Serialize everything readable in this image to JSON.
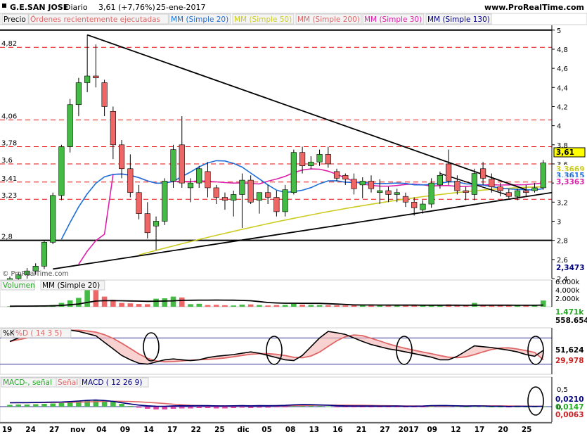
{
  "header": {
    "title": "G.E.SAN JOSE",
    "period": "Diario",
    "quote": "3,61 (+7,76%)",
    "date": "25-ene-2017",
    "site": "www.ProRealTime.com"
  },
  "legend_price": [
    {
      "label": "Precio",
      "color": "#000000"
    },
    {
      "label": "Órdenes recientemente ejecutadas",
      "color": "#e06666"
    },
    {
      "label": "MM (Simple 20)",
      "color": "#1e6fd9"
    },
    {
      "label": "MM (Simple 50)",
      "color": "#cccc22"
    },
    {
      "label": "MM (Simple 200)",
      "color": "#e06666"
    },
    {
      "label": "MM (Simple 30)",
      "color": "#dd22aa"
    },
    {
      "label": "MM (Simple 130)",
      "color": "#000080"
    }
  ],
  "watermark": "© ProRealTime.com",
  "price_axis": {
    "ticks": [
      "5",
      "4,8",
      "4,6",
      "4,4",
      "4,2",
      "4",
      "3,8",
      "3,6",
      "3,4",
      "3,2",
      "3",
      "2,8",
      "2,6",
      "2,4"
    ],
    "left_levels": [
      "4,82",
      "4,06",
      "3,78",
      "3,6",
      "3,41",
      "3,23",
      "2,8"
    ],
    "badges": [
      {
        "text": "3,61",
        "bg": "#ffff00",
        "fg": "#000000"
      },
      {
        "text": "3,3669",
        "bg": "#ffffff",
        "fg": "#cccc22"
      },
      {
        "text": "3,3615",
        "bg": "#ffffff",
        "fg": "#1e6fd9"
      },
      {
        "text": "3,3363",
        "bg": "#ffffff",
        "fg": "#dd22aa"
      },
      {
        "text": "2,3473",
        "bg": "#ffffff",
        "fg": "#000080"
      }
    ]
  },
  "volume_panel": {
    "legend": [
      {
        "label": "Volumen",
        "color": "#22aa22"
      },
      {
        "label": "MM (Simple 20)",
        "color": "#000000"
      }
    ],
    "ticks": [
      "6.000k",
      "4.000k",
      "2.000k"
    ],
    "badges": [
      {
        "text": "1.471k",
        "fg": "#22aa22"
      },
      {
        "text": "558.654",
        "fg": "#000000"
      }
    ]
  },
  "stoch_panel": {
    "legend": [
      {
        "label": "%K",
        "color": "#000000"
      },
      {
        "label": "%D ( 14 3 5)",
        "color": "#e06666"
      }
    ],
    "badges": [
      {
        "text": "51,624",
        "fg": "#000000"
      },
      {
        "text": "29,978",
        "fg": "#cc2222"
      }
    ]
  },
  "macd_panel": {
    "legend": [
      {
        "label": "MACD-, señal",
        "color": "#22aa22"
      },
      {
        "label": "Señal",
        "color": "#e06666"
      },
      {
        "label": "MACD ( 12 26 9)",
        "color": "#000080"
      }
    ],
    "ticks": [
      "0,5",
      "0"
    ],
    "badges": [
      {
        "text": "0,0210",
        "fg": "#000080"
      },
      {
        "text": "0,0147",
        "fg": "#22aa22"
      },
      {
        "text": "0,0063",
        "fg": "#cc2222"
      }
    ]
  },
  "x_axis": {
    "labels": [
      "19",
      "24",
      "27",
      "nov",
      "04",
      "09",
      "14",
      "17",
      "22",
      "25",
      "dic",
      "05",
      "08",
      "13",
      "16",
      "21",
      "27",
      "2017",
      "09",
      "12",
      "17",
      "20",
      "25"
    ]
  },
  "chart_data": {
    "type": "candlestick",
    "instrument": "G.E.SAN JOSE",
    "ylim": [
      2.4,
      5.05
    ],
    "candles": [
      [
        2.35,
        2.42,
        2.28,
        2.4
      ],
      [
        2.4,
        2.47,
        2.36,
        2.44
      ],
      [
        2.44,
        2.51,
        2.4,
        2.48
      ],
      [
        2.48,
        2.56,
        2.44,
        2.53
      ],
      [
        2.53,
        2.8,
        2.5,
        2.78
      ],
      [
        2.78,
        3.3,
        2.76,
        3.27
      ],
      [
        3.27,
        3.8,
        3.22,
        3.78
      ],
      [
        3.78,
        4.28,
        3.72,
        4.22
      ],
      [
        4.22,
        4.5,
        4.1,
        4.45
      ],
      [
        4.45,
        4.95,
        4.35,
        4.52
      ],
      [
        4.52,
        4.85,
        4.4,
        4.5
      ],
      [
        4.45,
        4.48,
        4.1,
        4.2
      ],
      [
        4.15,
        4.2,
        3.65,
        3.8
      ],
      [
        3.8,
        3.85,
        3.45,
        3.55
      ],
      [
        3.55,
        3.7,
        3.25,
        3.3
      ],
      [
        3.3,
        3.38,
        3.02,
        3.08
      ],
      [
        3.08,
        3.2,
        2.82,
        2.88
      ],
      [
        2.95,
        3.05,
        2.7,
        3.0
      ],
      [
        3.0,
        3.45,
        2.96,
        3.42
      ],
      [
        3.42,
        3.8,
        3.35,
        3.75
      ],
      [
        3.8,
        4.1,
        3.35,
        3.4
      ],
      [
        3.35,
        3.45,
        3.2,
        3.4
      ],
      [
        3.4,
        3.58,
        3.35,
        3.55
      ],
      [
        3.52,
        3.62,
        3.25,
        3.35
      ],
      [
        3.35,
        3.38,
        3.18,
        3.25
      ],
      [
        3.25,
        3.3,
        3.12,
        3.22
      ],
      [
        3.22,
        3.32,
        3.05,
        3.28
      ],
      [
        3.28,
        3.5,
        2.93,
        3.43
      ],
      [
        3.43,
        3.48,
        3.18,
        3.2
      ],
      [
        3.22,
        3.3,
        3.08,
        3.3
      ],
      [
        3.3,
        3.38,
        3.18,
        3.25
      ],
      [
        3.25,
        3.32,
        3.05,
        3.1
      ],
      [
        3.1,
        3.38,
        3.05,
        3.33
      ],
      [
        3.3,
        3.75,
        3.28,
        3.72
      ],
      [
        3.72,
        3.78,
        3.5,
        3.58
      ],
      [
        3.58,
        3.68,
        3.55,
        3.62
      ],
      [
        3.62,
        3.75,
        3.58,
        3.7
      ],
      [
        3.7,
        3.78,
        3.56,
        3.6
      ],
      [
        3.52,
        3.55,
        3.42,
        3.45
      ],
      [
        3.48,
        3.5,
        3.38,
        3.44
      ],
      [
        3.44,
        3.5,
        3.28,
        3.34
      ],
      [
        3.38,
        3.46,
        3.24,
        3.42
      ],
      [
        3.42,
        3.48,
        3.3,
        3.34
      ],
      [
        3.3,
        3.44,
        3.18,
        3.32
      ],
      [
        3.32,
        3.36,
        3.2,
        3.28
      ],
      [
        3.28,
        3.34,
        3.2,
        3.3
      ],
      [
        3.26,
        3.3,
        3.15,
        3.2
      ],
      [
        3.2,
        3.25,
        3.06,
        3.14
      ],
      [
        3.12,
        3.22,
        3.08,
        3.18
      ],
      [
        3.18,
        3.45,
        3.14,
        3.4
      ],
      [
        3.38,
        3.52,
        3.34,
        3.48
      ],
      [
        3.6,
        3.75,
        3.38,
        3.42
      ],
      [
        3.42,
        3.48,
        3.28,
        3.32
      ],
      [
        3.32,
        3.36,
        3.22,
        3.3
      ],
      [
        3.28,
        3.55,
        3.22,
        3.5
      ],
      [
        3.55,
        3.62,
        3.38,
        3.45
      ],
      [
        3.44,
        3.5,
        3.3,
        3.36
      ],
      [
        3.36,
        3.4,
        3.26,
        3.32
      ],
      [
        3.3,
        3.34,
        3.24,
        3.26
      ],
      [
        3.26,
        3.34,
        3.22,
        3.32
      ],
      [
        3.32,
        3.38,
        3.26,
        3.3
      ],
      [
        3.32,
        3.4,
        3.3,
        3.35
      ],
      [
        3.35,
        3.64,
        3.33,
        3.61
      ]
    ],
    "volume_k": [
      120,
      180,
      150,
      210,
      260,
      420,
      900,
      1500,
      2100,
      4300,
      4700,
      2400,
      1650,
      900,
      800,
      650,
      600,
      1900,
      2000,
      2400,
      2200,
      600,
      700,
      400,
      450,
      350,
      300,
      500,
      550,
      400,
      300,
      380,
      420,
      700,
      500,
      420,
      400,
      380,
      340,
      300,
      320,
      360,
      420,
      300,
      280,
      260,
      240,
      280,
      300,
      320,
      400,
      560,
      420,
      300,
      900,
      420,
      300,
      260,
      240,
      280,
      260,
      300,
      1471
    ],
    "volume_ma_k": 558.654,
    "stochastic": {
      "k": 51.624,
      "d": 29.978
    },
    "macd": {
      "macd": 0.021,
      "signal": 0.0147,
      "histogram": 0.0063
    }
  }
}
